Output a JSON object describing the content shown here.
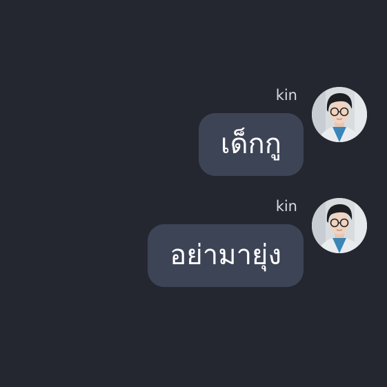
{
  "messages": [
    {
      "sender": "kin",
      "text": "เด็กกู",
      "avatar_icon": "user-avatar-photo"
    },
    {
      "sender": "kin",
      "text": "อย่ามายุ่ง",
      "avatar_icon": "user-avatar-photo"
    }
  ],
  "colors": {
    "background": "#242730",
    "bubble": "#3d4456",
    "bubble_text": "#ffffff",
    "sender_text": "#d9dbe0"
  }
}
